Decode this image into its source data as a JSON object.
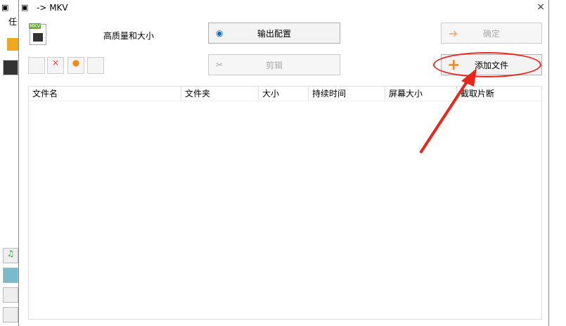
{
  "window": {
    "title": "-> MKV",
    "close_label": "×"
  },
  "background": {
    "partial_label": "任"
  },
  "profile": {
    "label": "高质量和大小",
    "format_badge": "MKV"
  },
  "buttons": {
    "output_config": "输出配置",
    "clip": "剪辑",
    "ok": "确定",
    "add_file": "添加文件"
  },
  "table": {
    "columns": [
      "文件名",
      "文件夹",
      "大小",
      "持续时间",
      "屏幕大小",
      "截取片断"
    ]
  },
  "colors": {
    "annotation": "#e8261b"
  }
}
